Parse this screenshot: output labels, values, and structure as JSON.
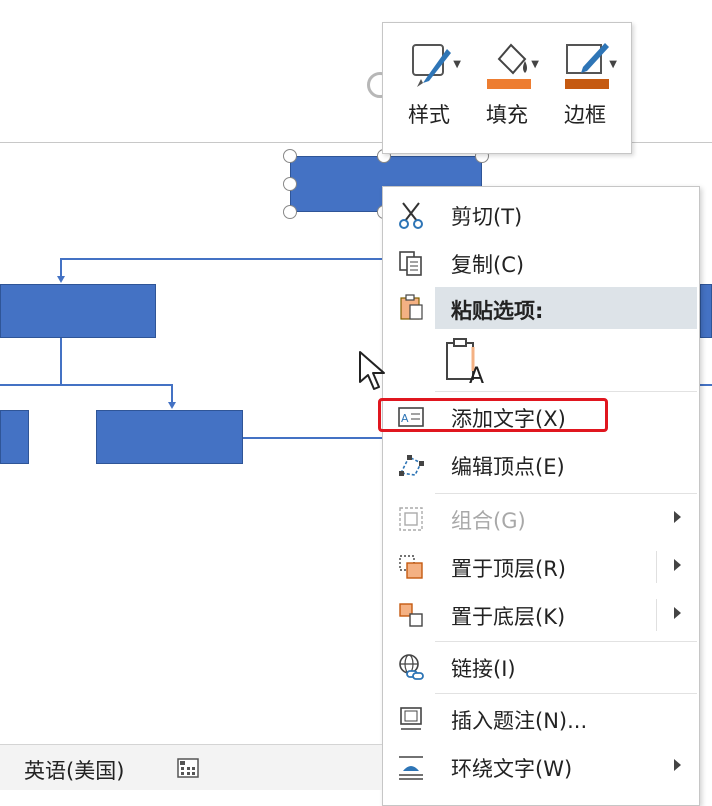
{
  "mini_toolbar": {
    "style_label": "样式",
    "fill_label": "填充",
    "border_label": "边框",
    "fill_color": "#ed7d31",
    "border_color": "#c55a11"
  },
  "context_menu": {
    "cut": "剪切(T)",
    "copy": "复制(C)",
    "paste_options": "粘贴选项:",
    "add_text": "添加文字(X)",
    "edit_points": "编辑顶点(E)",
    "group": "组合(G)",
    "bring_to_front": "置于顶层(R)",
    "send_to_back": "置于底层(K)",
    "link": "链接(I)",
    "insert_caption": "插入题注(N)...",
    "wrap_text": "环绕文字(W)"
  },
  "status_bar": {
    "language": "英语(美国)"
  },
  "colors": {
    "shape_fill": "#4472c4",
    "highlight": "#e0161f"
  }
}
